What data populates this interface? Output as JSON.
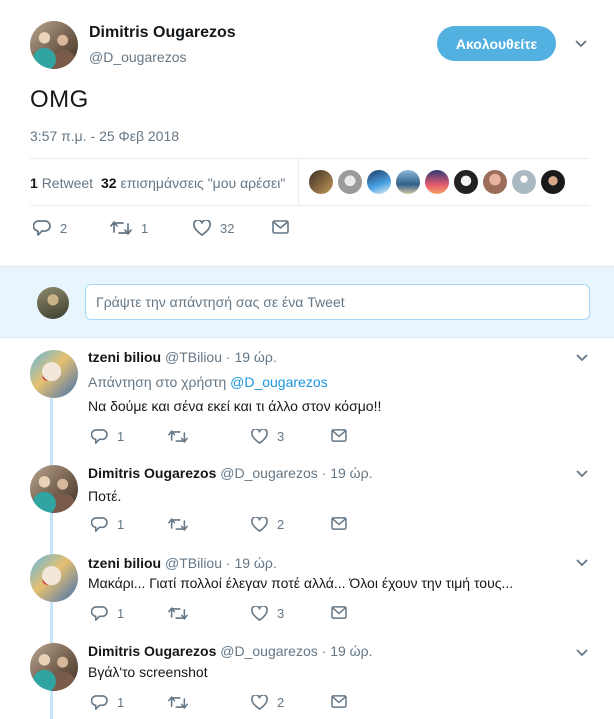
{
  "main_tweet": {
    "author_name": "Dimitris Ougarezos",
    "author_handle": "@D_ougarezos",
    "follow_label": "Ακολουθείτε",
    "text": "OMG",
    "timestamp": "3:57 π.μ. - 25 Φεβ 2018",
    "retweets_count": "1",
    "retweets_label": "Retweet",
    "likes_count": "32",
    "likes_label": "επισημάνσεις \"μου αρέσει\"",
    "action_counts": {
      "reply": "2",
      "retweet": "1",
      "like": "32"
    }
  },
  "reply_box": {
    "placeholder": "Γράψτε την απάντησή σας σε ένα Tweet"
  },
  "replies": [
    {
      "author_name": "tzeni biliou",
      "author_handle": "@TBiliou",
      "time": "· 19 ώρ.",
      "reply_to_label": "Απάντηση στο χρήστη",
      "reply_to_handle": "@D_ougarezos",
      "text": "Να δούμε και σένα εκεί και τι άλλο στον κόσμο!!",
      "reply_count": "1",
      "retweet_count": "",
      "like_count": "3"
    },
    {
      "author_name": "Dimitris Ougarezos",
      "author_handle": "@D_ougarezos",
      "time": "· 19 ώρ.",
      "text": "Ποτέ.",
      "reply_count": "1",
      "retweet_count": "",
      "like_count": "2"
    },
    {
      "author_name": "tzeni biliou",
      "author_handle": "@TBiliou",
      "time": "· 19 ώρ.",
      "text": "Μακάρι... Γιατί πολλοί έλεγαν ποτέ αλλά... Όλοι έχουν την τιμή τους...",
      "reply_count": "1",
      "retweet_count": "",
      "like_count": "3"
    },
    {
      "author_name": "Dimitris Ougarezos",
      "author_handle": "@D_ougarezos",
      "time": "· 19 ώρ.",
      "text": "Βγάλ'το screenshot",
      "reply_count": "1",
      "retweet_count": "",
      "like_count": "2"
    }
  ],
  "colors": {
    "accent": "#52b1e0",
    "link": "#1b95e0",
    "muted": "#657786",
    "thread_line": "#c4e5f7",
    "reply_box_bg": "#e8f5fd"
  },
  "icons": [
    "reply-icon",
    "retweet-icon",
    "like-icon",
    "dm-icon",
    "chevron-down-icon"
  ]
}
